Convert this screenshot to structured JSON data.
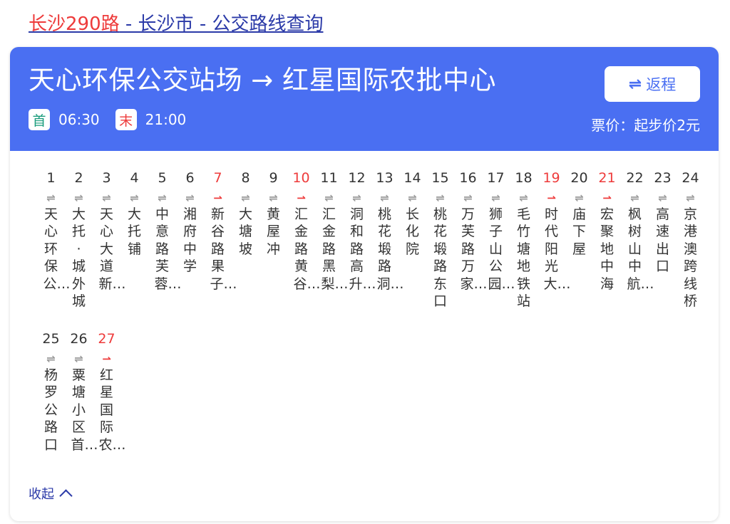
{
  "heading": {
    "route_name": "长沙290路",
    "rest": " - 长沙市 - 公交路线查询"
  },
  "header": {
    "title": "天心环保公交站场 → 红星国际农批中心",
    "return_label": "返程",
    "first_badge": "首",
    "first_time": "06:30",
    "last_badge": "末",
    "last_time": "21:00",
    "fare": "票价：起步价2元"
  },
  "stops": [
    {
      "num": "1",
      "name": "天心环保公…",
      "red": false
    },
    {
      "num": "2",
      "name": "大托·城外城",
      "red": false
    },
    {
      "num": "3",
      "name": "天心大道新…",
      "red": false
    },
    {
      "num": "4",
      "name": "大托铺",
      "red": false
    },
    {
      "num": "5",
      "name": "中意路芙蓉…",
      "red": false
    },
    {
      "num": "6",
      "name": "湘府中学",
      "red": false
    },
    {
      "num": "7",
      "name": "新谷路果子…",
      "red": true
    },
    {
      "num": "8",
      "name": "大塘坡",
      "red": false
    },
    {
      "num": "9",
      "name": "黄屋冲",
      "red": false
    },
    {
      "num": "10",
      "name": "汇金路黄谷…",
      "red": true
    },
    {
      "num": "11",
      "name": "汇金路黑梨…",
      "red": false
    },
    {
      "num": "12",
      "name": "洞和路高升…",
      "red": false
    },
    {
      "num": "13",
      "name": "桃花塅路洞…",
      "red": false
    },
    {
      "num": "14",
      "name": "长化院",
      "red": false
    },
    {
      "num": "15",
      "name": "桃花塅路东口",
      "red": false
    },
    {
      "num": "16",
      "name": "万芙路万家…",
      "red": false
    },
    {
      "num": "17",
      "name": "狮子山公园…",
      "red": false
    },
    {
      "num": "18",
      "name": "毛竹塘地铁站",
      "red": false
    },
    {
      "num": "19",
      "name": "时代阳光大…",
      "red": true
    },
    {
      "num": "20",
      "name": "庙下屋",
      "red": false
    },
    {
      "num": "21",
      "name": "宏聚地中海",
      "red": true
    },
    {
      "num": "22",
      "name": "枫树山中航…",
      "red": false
    },
    {
      "num": "23",
      "name": "高速出口",
      "red": false
    },
    {
      "num": "24",
      "name": "京港澳跨线桥",
      "red": false
    },
    {
      "num": "25",
      "name": "杨罗公路口",
      "red": false
    },
    {
      "num": "26",
      "name": "粟塘小区首…",
      "red": false
    },
    {
      "num": "27",
      "name": "红星国际农…",
      "red": true
    }
  ],
  "icons": {
    "two_way": "⇌",
    "one_way": "⇀"
  },
  "collapse_label": "收起",
  "colors": {
    "header": "#4a6ff2",
    "accent_red": "#ee3b3b",
    "link": "#2b3aa8"
  }
}
